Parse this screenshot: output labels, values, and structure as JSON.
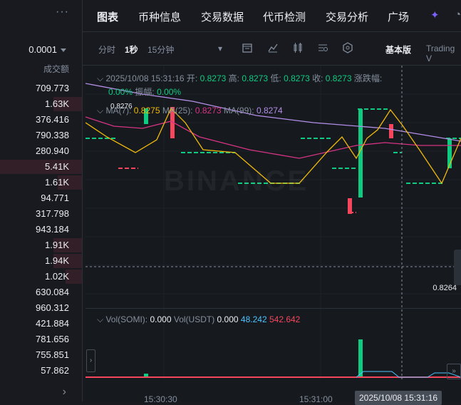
{
  "orderbook": {
    "more_label": "···",
    "precision": "0.0001",
    "column_header": "成交额",
    "rows": [
      {
        "v": "709.773",
        "d": 0
      },
      {
        "v": "1.63K",
        "d": 0.35
      },
      {
        "v": "376.416",
        "d": 0
      },
      {
        "v": "790.338",
        "d": 0
      },
      {
        "v": "280.940",
        "d": 0
      },
      {
        "v": "5.41K",
        "d": 1
      },
      {
        "v": "1.61K",
        "d": 0.3
      },
      {
        "v": "94.771",
        "d": 0
      },
      {
        "v": "317.798",
        "d": 0
      },
      {
        "v": "943.184",
        "d": 0
      },
      {
        "v": "1.91K",
        "d": 0.35
      },
      {
        "v": "1.94K",
        "d": 0.35
      },
      {
        "v": "1.02K",
        "d": 0.2
      },
      {
        "v": "630.084",
        "d": 0
      },
      {
        "v": "960.312",
        "d": 0
      },
      {
        "v": "421.884",
        "d": 0
      },
      {
        "v": "781.656",
        "d": 0
      },
      {
        "v": "755.851",
        "d": 0
      },
      {
        "v": "57.862",
        "d": 0
      }
    ],
    "expand_label": "›"
  },
  "tabs": [
    "图表",
    "币种信息",
    "交易数据",
    "代币检测",
    "交易分析",
    "广场"
  ],
  "toolbar": {
    "intervals": [
      "分时",
      "1秒",
      "15分钟"
    ],
    "selected_interval": "1秒",
    "view_basic": "基本版",
    "view_tv": "Trading V"
  },
  "legend": {
    "datetime": "2025/10/08 15:31:16",
    "open_label": "开:",
    "open": "0.8273",
    "high_label": "高:",
    "high": "0.8273",
    "low_label": "低:",
    "low": "0.8273",
    "close_label": "收:",
    "close": "0.8273",
    "change_label": "涨跌幅:",
    "change": "0.00%",
    "amp_label": "振幅:",
    "amp": "0.00%",
    "ma7_label": "MA(7):",
    "ma7": "0.8275",
    "ma25_label": "MA(25):",
    "ma25": "0.8273",
    "ma99_label": "MA(99):",
    "ma99": "0.8274"
  },
  "chart": {
    "watermark": "BINANCE",
    "high_marker": "0.8276",
    "crosshair_price": "0.8264",
    "colors": {
      "up": "#0ecb81",
      "down": "#f6465d",
      "ma7": "#f0b90b",
      "ma25": "#d63384",
      "ma99": "#b48ee8"
    }
  },
  "volume_legend": {
    "vol_somi_label": "Vol(SOMI):",
    "vol_somi": "0.000",
    "vol_usdt_label": "Vol(USDT)",
    "vol_usdt": "0.000",
    "ma_a": "48.242",
    "ma_b": "542.642"
  },
  "time_axis": {
    "t1": "15:30:30",
    "t2": "15:31:00",
    "cursor": "2025/10/08 15:31:16"
  }
}
